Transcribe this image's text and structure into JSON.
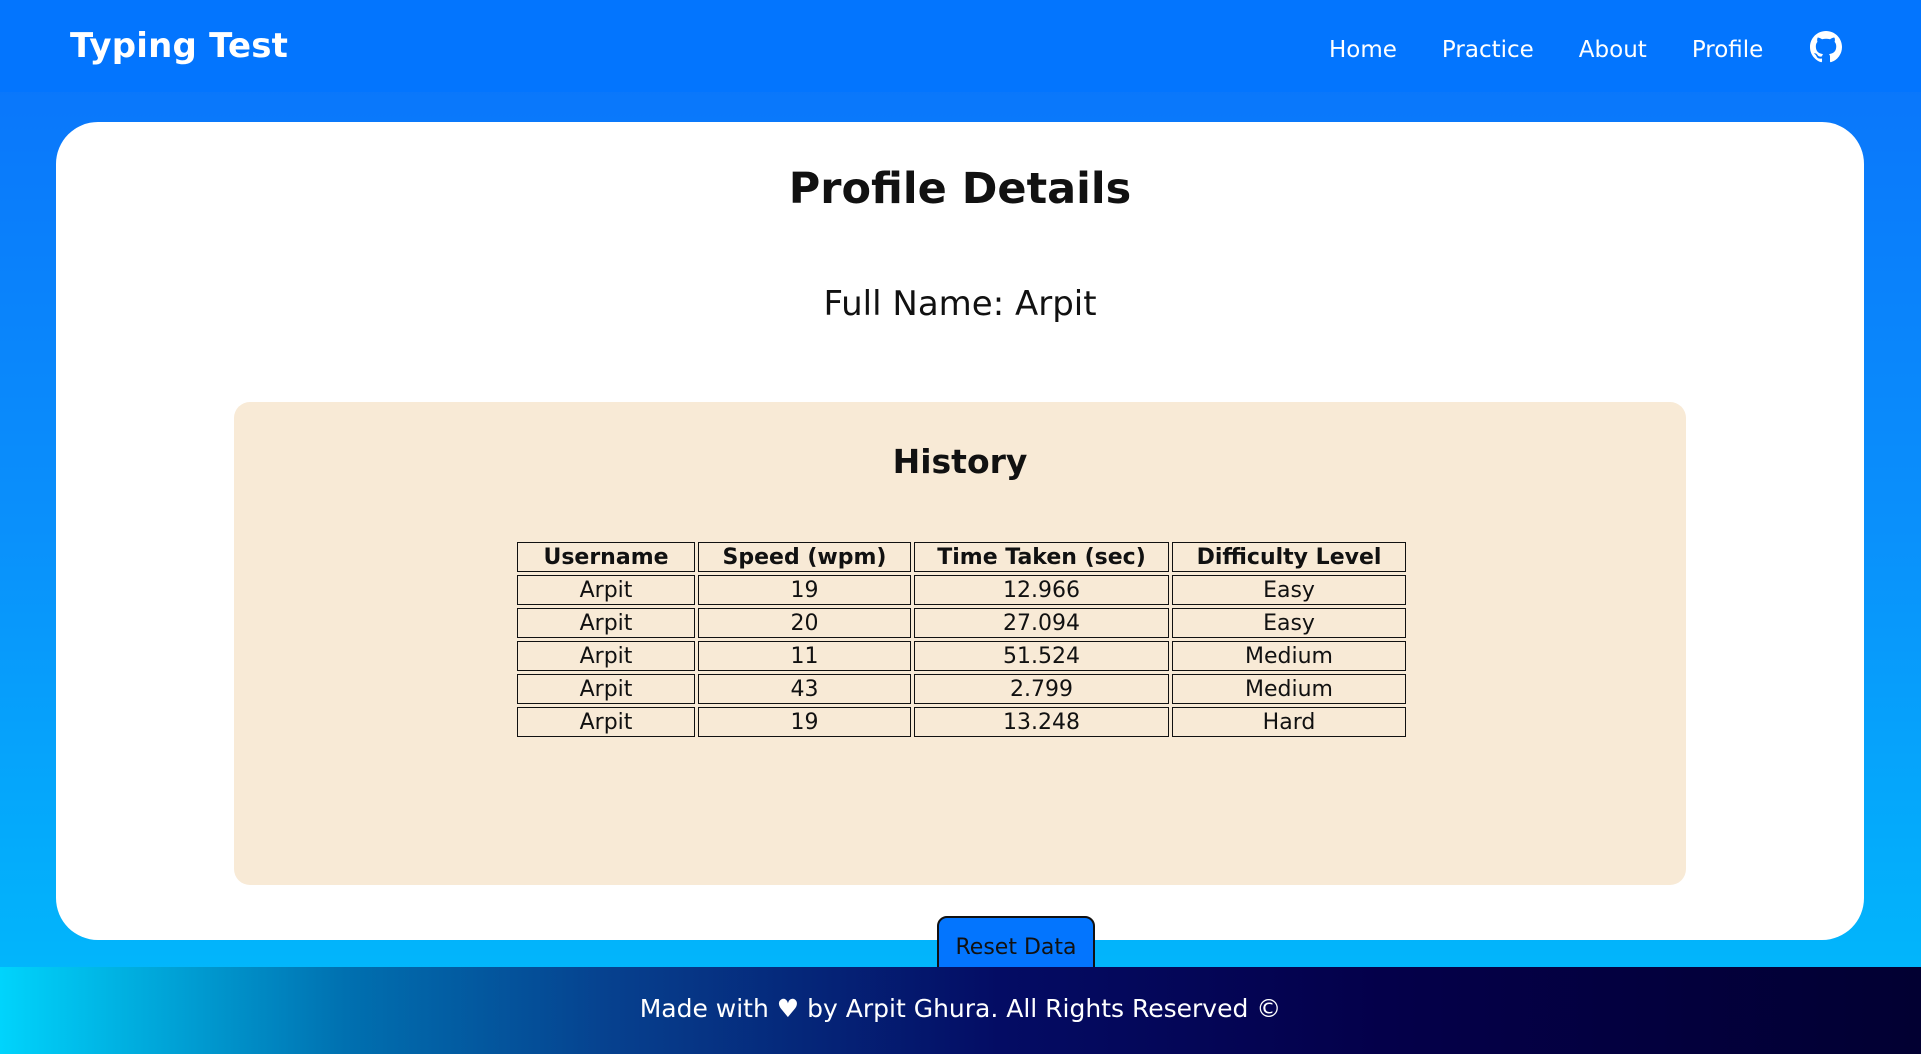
{
  "navbar": {
    "brand": "Typing Test",
    "links": [
      "Home",
      "Practice",
      "About",
      "Profile"
    ],
    "github_icon": "github-icon"
  },
  "main": {
    "title": "Profile Details",
    "full_name": "Full Name: Arpit",
    "history": {
      "title": "History",
      "columns": [
        "Username",
        "Speed (wpm)",
        "Time Taken (sec)",
        "Difficulty Level"
      ],
      "rows": [
        [
          "Arpit",
          "19",
          "12.966",
          "Easy"
        ],
        [
          "Arpit",
          "20",
          "27.094",
          "Easy"
        ],
        [
          "Arpit",
          "11",
          "51.524",
          "Medium"
        ],
        [
          "Arpit",
          "43",
          "2.799",
          "Medium"
        ],
        [
          "Arpit",
          "19",
          "13.248",
          "Hard"
        ]
      ],
      "reset_label": "Reset Data"
    }
  },
  "footer": {
    "text": "Made with ♥ by Arpit Ghura. All Rights Reserved ©"
  },
  "colors": {
    "navbar": "#0375fe",
    "history_bg": "#f8ead6",
    "button": "#0375fe"
  }
}
